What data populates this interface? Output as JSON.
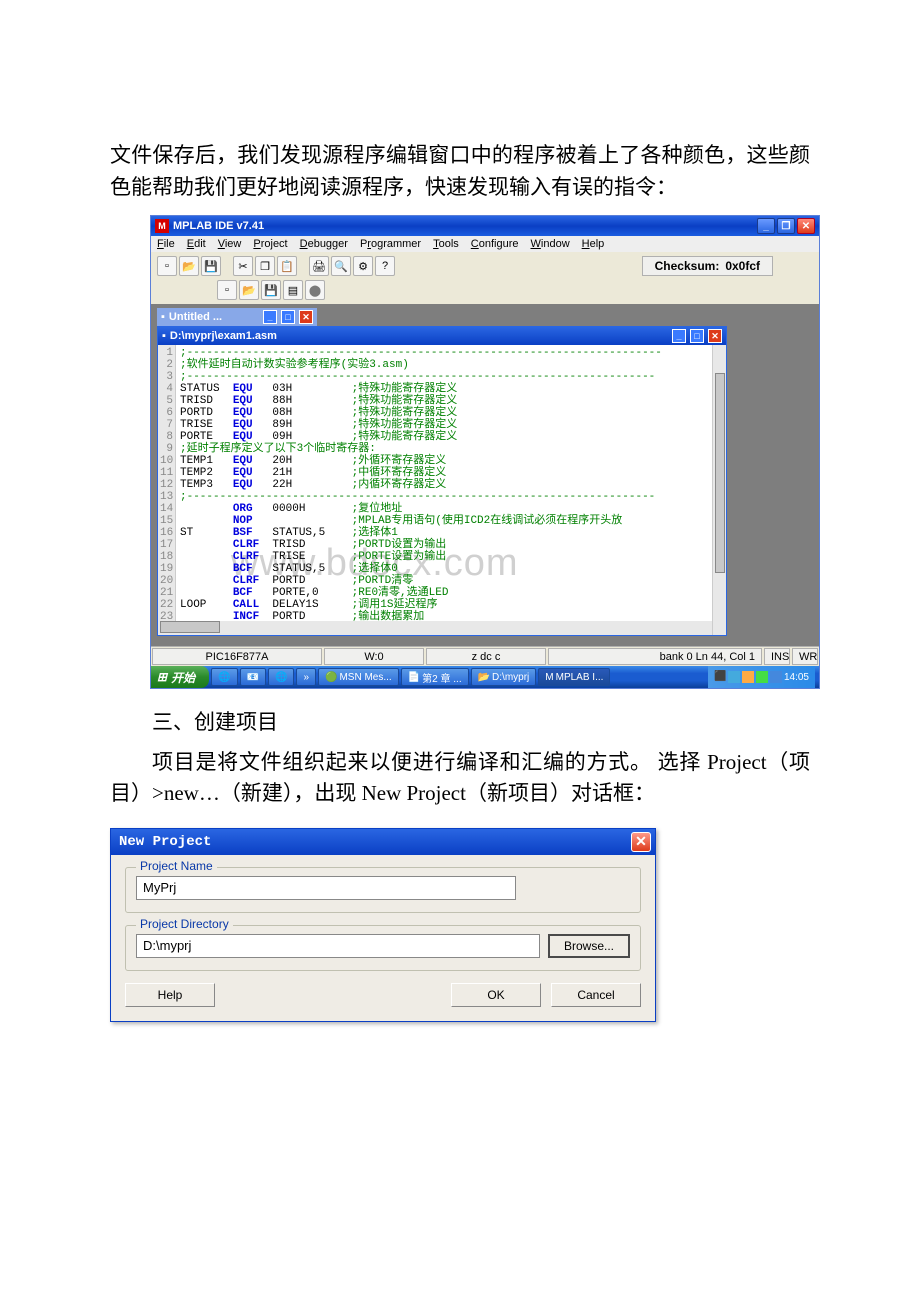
{
  "paragraphs": {
    "p1": "文件保存后，我们发现源程序编辑窗口中的程序被着上了各种颜色，这些颜色能帮助我们更好地阅读源程序，快速发现输入有误的指令：",
    "h2": "三、创建项目",
    "p2": "项目是将文件组织起来以便进行编译和汇编的方式。 选择 Project（项目）>new…（新建），出现 New Project（新项目）对话框："
  },
  "ide": {
    "title": "MPLAB IDE v7.41",
    "menu": {
      "file": "File",
      "edit": "Edit",
      "view": "View",
      "project": "Project",
      "debugger": "Debugger",
      "programmer": "Programmer",
      "tools": "Tools",
      "configure": "Configure",
      "window": "Window",
      "help": "Help"
    },
    "checksum_label": "Checksum:",
    "checksum_value": "0x0fcf",
    "untitled_title": "Untitled ...",
    "editor_title": "D:\\myprj\\exam1.asm",
    "watermark": "www.bdocx.com",
    "code": [
      {
        "c": ";------------------------------------------------------------------------"
      },
      {
        "c": ";软件延时自动计数实验参考程序(实验3.asm)"
      },
      {
        "c": ";-----------------------------------------------------------------------"
      },
      {
        "l": "STATUS",
        "k": "EQU",
        "o": "03H",
        "c": ";特殊功能寄存器定义"
      },
      {
        "l": "TRISD",
        "k": "EQU",
        "o": "88H",
        "c": ";特殊功能寄存器定义"
      },
      {
        "l": "PORTD",
        "k": "EQU",
        "o": "08H",
        "c": ";特殊功能寄存器定义"
      },
      {
        "l": "TRISE",
        "k": "EQU",
        "o": "89H",
        "c": ";特殊功能寄存器定义"
      },
      {
        "l": "PORTE",
        "k": "EQU",
        "o": "09H",
        "c": ";特殊功能寄存器定义"
      },
      {
        "c": ";延时子程序定义了以下3个临时寄存器:"
      },
      {
        "l": "TEMP1",
        "k": "EQU",
        "o": "20H",
        "c": ";外循环寄存器定义"
      },
      {
        "l": "TEMP2",
        "k": "EQU",
        "o": "21H",
        "c": ";中循环寄存器定义"
      },
      {
        "l": "TEMP3",
        "k": "EQU",
        "o": "22H",
        "c": ";内循环寄存器定义"
      },
      {
        "c": ";-----------------------------------------------------------------------"
      },
      {
        "l": "",
        "k": "ORG",
        "o": "0000H",
        "c": ";复位地址"
      },
      {
        "l": "",
        "k": "NOP",
        "o": "",
        "c": ";MPLAB专用语句(使用ICD2在线调试必须在程序开头放"
      },
      {
        "l": "ST",
        "k": "BSF",
        "o": "STATUS,5",
        "c": ";选择体1"
      },
      {
        "l": "",
        "k": "CLRF",
        "o": "TRISD",
        "c": ";PORTD设置为输出"
      },
      {
        "l": "",
        "k": "CLRF",
        "o": "TRISE",
        "c": ";PORTE设置为输出"
      },
      {
        "l": "",
        "k": "BCF",
        "o": "STATUS,5",
        "c": ";选择体0"
      },
      {
        "l": "",
        "k": "CLRF",
        "o": "PORTD",
        "c": ";PORTD清零"
      },
      {
        "l": "",
        "k": "BCF",
        "o": "PORTE,0",
        "c": ";RE0清零,选通LED"
      },
      {
        "l": "LOOP",
        "k": "CALL",
        "o": "DELAY1S",
        "c": ";调用1S延迟程序"
      },
      {
        "l": "",
        "k": "INCF",
        "o": "PORTD",
        "c": ";输出数据累加"
      }
    ],
    "status": {
      "device": "PIC16F877A",
      "wflag": "W:0",
      "zdc": "z dc c",
      "cursor": "bank 0 Ln 44, Col 1",
      "ins": "INS",
      "wr": "WR"
    },
    "taskbar": {
      "start": "开始",
      "items": [
        "",
        "",
        "",
        "",
        "MSN Mes...",
        "第2 章 ...",
        "D:\\myprj",
        "MPLAB I..."
      ],
      "time": "14:05"
    }
  },
  "dialog": {
    "title": "New Project",
    "name_label": "Project Name",
    "name_value": "MyPrj",
    "dir_label": "Project Directory",
    "dir_value": "D:\\myprj",
    "browse": "Browse...",
    "help": "Help",
    "ok": "OK",
    "cancel": "Cancel"
  }
}
